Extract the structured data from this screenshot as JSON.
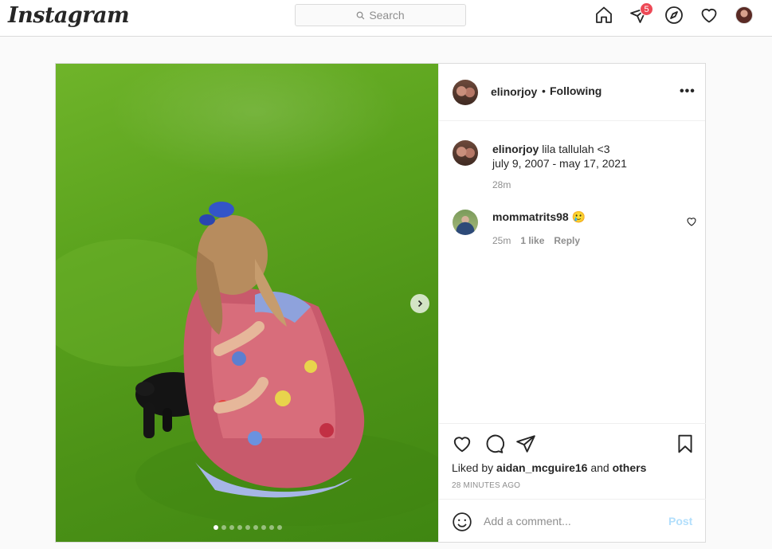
{
  "nav": {
    "logo": "Instagram",
    "search_placeholder": "Search",
    "notification_count": "5",
    "icons": [
      "home-icon",
      "direct-icon",
      "explore-icon",
      "activity-heart-icon",
      "profile-avatar"
    ]
  },
  "post": {
    "author": "elinorjoy",
    "separator": "•",
    "follow_label": "Following",
    "more_label": "•••",
    "carousel_total": 9,
    "carousel_active": 1,
    "caption": {
      "user": "elinorjoy",
      "text_line1": "lila tallulah <3",
      "text_line2": "july 9, 2007 - may 17, 2021",
      "time": "28m"
    },
    "comments": [
      {
        "user": "mommatrits98",
        "text": "🥲",
        "time": "25m",
        "likes": "1 like",
        "reply_label": "Reply"
      }
    ],
    "liked_by_prefix": "Liked by",
    "liked_by_user": "aidan_mcguire16",
    "liked_by_and": "and",
    "liked_by_others": "others",
    "timestamp": "28 MINUTES AGO",
    "comment_placeholder": "Add a comment...",
    "post_label": "Post"
  },
  "colors": {
    "accent_blue_disabled": "#b2dffc",
    "badge_red": "#ed4956",
    "border": "#dbdbdb"
  }
}
